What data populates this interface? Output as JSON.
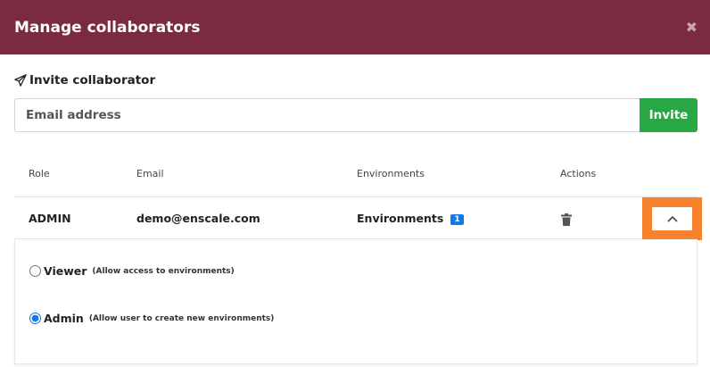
{
  "modal": {
    "title": "Manage collaborators",
    "close_glyph": "✖"
  },
  "invite": {
    "label": "Invite collaborator",
    "icon": "paper-plane-icon",
    "email_placeholder": "Email address",
    "email_value": "",
    "button_label": "Invite",
    "button_color": "#28a745"
  },
  "table": {
    "headers": {
      "role": "Role",
      "email": "Email",
      "environments": "Environments",
      "actions": "Actions"
    },
    "rows": [
      {
        "role": "ADMIN",
        "email": "demo@enscale.com",
        "environments_label": "Environments",
        "environments_count": "1",
        "actions_icon": "trash-icon",
        "toggle_icon": "chevron-up-icon"
      }
    ]
  },
  "permissions": {
    "options": [
      {
        "label": "Viewer",
        "hint": "(Allow access to environments)",
        "selected": false
      },
      {
        "label": "Admin",
        "hint": "(Allow user to create new environments)",
        "selected": true
      }
    ]
  },
  "colors": {
    "header_bg": "#7a2a41",
    "highlight": "#f7832e",
    "badge": "#1479e8"
  }
}
